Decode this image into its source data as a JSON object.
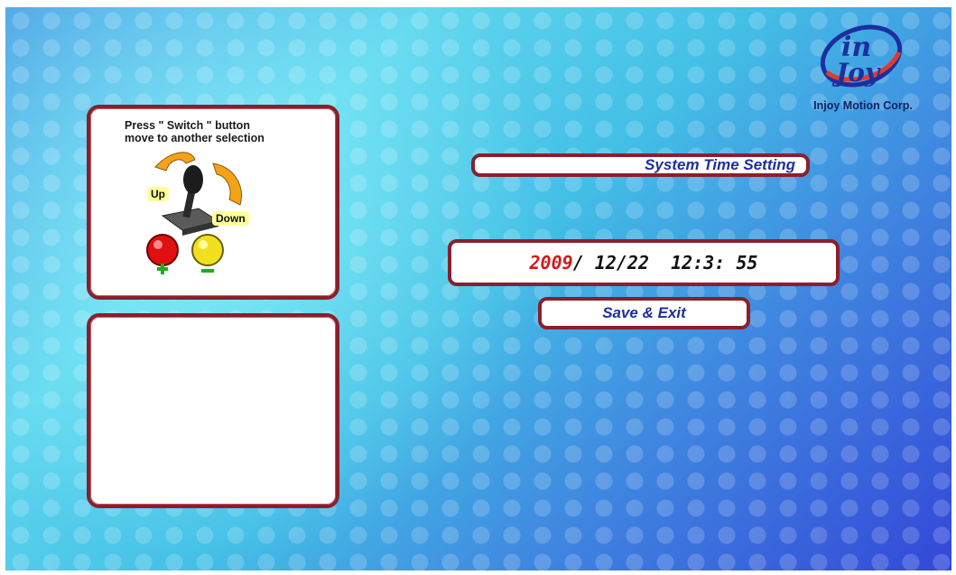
{
  "help": {
    "line1": "Press \" Switch \" button",
    "line2": "move to another selection",
    "up_label": "Up",
    "down_label": "Down",
    "plus_symbol": "+",
    "minus_symbol": "−"
  },
  "logo": {
    "brand_top": "in",
    "brand_bottom": "Joy",
    "company": "Injoy Motion Corp."
  },
  "setting": {
    "title": "System Time Setting",
    "time": {
      "year": "2009",
      "sep1": "/",
      "month": "12",
      "sep2": "/",
      "day": "22",
      "hour": "12",
      "colon1": ":",
      "minute": "3",
      "colon2": ":",
      "second": "55"
    },
    "save_label": "Save & Exit"
  },
  "colors": {
    "panel_border": "#8a1f2c",
    "title_text": "#1c2f9e",
    "year_text": "#d21a1a"
  }
}
